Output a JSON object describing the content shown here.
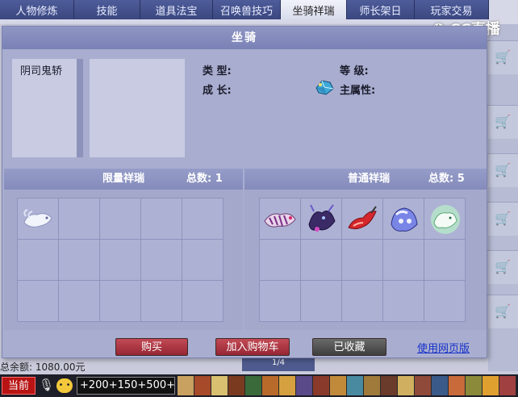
{
  "top_tabs": [
    {
      "label": "人物修炼",
      "active": false
    },
    {
      "label": "技能",
      "active": false
    },
    {
      "label": "道具法宝",
      "active": false
    },
    {
      "label": "召唤兽技巧",
      "active": false
    },
    {
      "label": "坐骑祥瑞",
      "active": true
    },
    {
      "label": "师长架日",
      "active": false
    },
    {
      "label": "玩家交易",
      "active": false
    }
  ],
  "watermark": {
    "text": "CC直播"
  },
  "panel": {
    "title": "坐骑",
    "mount_list": [
      {
        "label": "阴司鬼轿"
      }
    ],
    "attributes": {
      "type_label": "类 型:",
      "level_label": "等 级:",
      "growth_label": "成 长:",
      "main_attr_label": "主属性:",
      "main_attr_icon": "gem-icon"
    },
    "limited_section": {
      "title": "限量祥瑞",
      "count_label": "总数: 1"
    },
    "normal_section": {
      "title": "普通祥瑞",
      "count_label": "总数: 5"
    },
    "limited_items": [
      {
        "name": "white-fox-mount-icon"
      }
    ],
    "normal_items": [
      {
        "name": "skeleton-mount-icon"
      },
      {
        "name": "dark-demon-mount-icon"
      },
      {
        "name": "red-flame-mount-icon"
      },
      {
        "name": "blue-beast-mount-icon"
      },
      {
        "name": "ice-spirit-mount-icon"
      }
    ],
    "buttons": {
      "buy": "购买",
      "add_cart": "加入购物车",
      "favorited": "已收藏",
      "web_link": "使用网页版"
    }
  },
  "background": {
    "balance": "总余额: 1080.00元",
    "page": "1/4"
  },
  "bottom_bar": {
    "channel": "当前",
    "hp_readout": "+200+150+500+"
  },
  "colors": {
    "panel_bg": "#a9aed0",
    "title_bar": "#7a81b5",
    "buy_button": "#962634",
    "fav_button": "#3e3e3e",
    "link": "#1530c8"
  }
}
